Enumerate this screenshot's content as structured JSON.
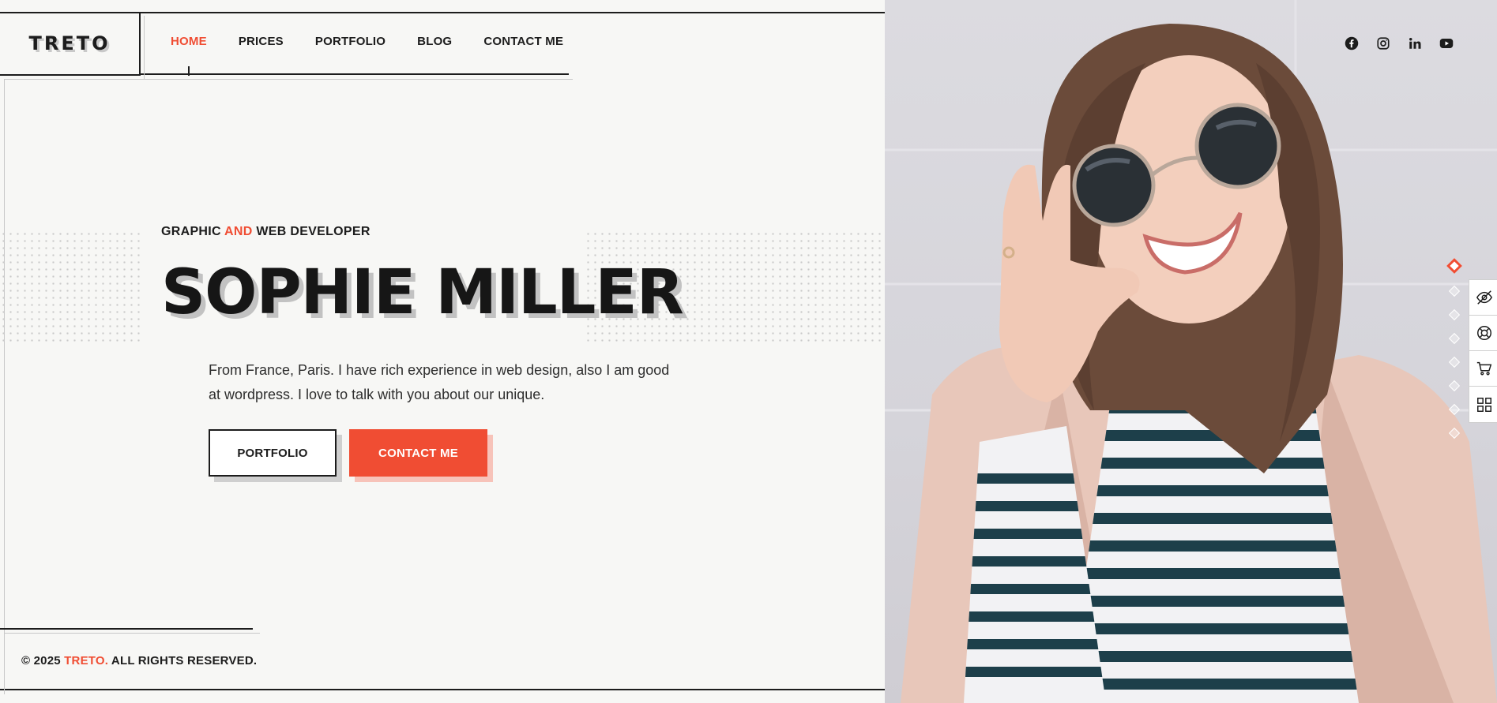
{
  "brand": {
    "logo": "TRETO"
  },
  "nav": {
    "items": [
      {
        "label": "HOME",
        "active": true
      },
      {
        "label": "PRICES",
        "active": false
      },
      {
        "label": "PORTFOLIO",
        "active": false
      },
      {
        "label": "BLOG",
        "active": false
      },
      {
        "label": "CONTACT ME",
        "active": false
      }
    ]
  },
  "hero": {
    "tagline_pre": "GRAPHIC ",
    "tagline_accent": "AND",
    "tagline_post": " WEB DEVELOPER",
    "name": "SOPHIE MILLER",
    "description": "From France, Paris. I have rich experience in web design, also I am good at wordpress. I love to talk with you about our unique.",
    "btn_portfolio": "PORTFOLIO",
    "btn_contact": "CONTACT ME"
  },
  "footer": {
    "copy_pre": "© 2025 ",
    "copy_brand": "TRETO.",
    "copy_post": " ALL RIGHTS RESERVED."
  },
  "socials": [
    "facebook-icon",
    "instagram-icon",
    "linkedin-icon",
    "youtube-icon"
  ],
  "pager": {
    "count": 8,
    "active_index": 0
  },
  "side_tools": [
    "eye-off-icon",
    "lifebuoy-icon",
    "cart-icon",
    "grid-icon"
  ],
  "colors": {
    "accent": "#f04d33",
    "text": "#1c1c1c",
    "background": "#f7f7f5"
  }
}
